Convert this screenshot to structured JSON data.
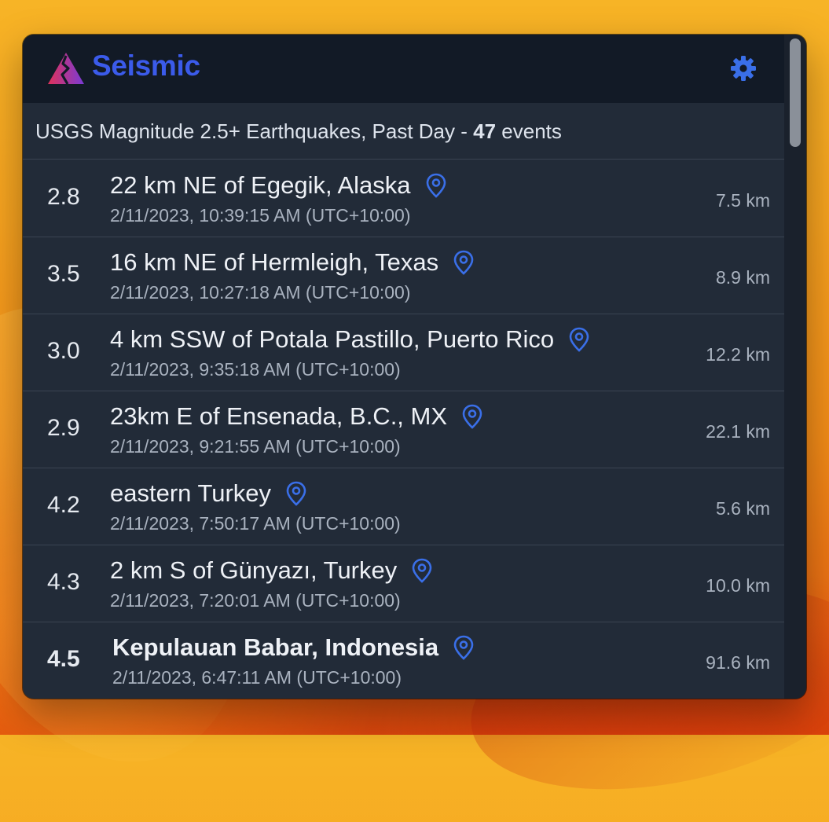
{
  "app": {
    "title": "Seismic",
    "accent_color": "#3b5bea",
    "settings_icon": "gear-icon"
  },
  "summary": {
    "prefix": "USGS Magnitude 2.5+ Earthquakes, Past Day - ",
    "count": "47",
    "suffix": " events"
  },
  "events": [
    {
      "mag": "2.8",
      "place": "22 km NE of Egegik, Alaska",
      "time": "2/11/2023, 10:39:15 AM (UTC+10:00)",
      "depth": "7.5 km"
    },
    {
      "mag": "3.5",
      "place": "16 km NE of Hermleigh, Texas",
      "time": "2/11/2023, 10:27:18 AM (UTC+10:00)",
      "depth": "8.9 km"
    },
    {
      "mag": "3.0",
      "place": "4 km SSW of Potala Pastillo, Puerto Rico",
      "time": "2/11/2023, 9:35:18 AM (UTC+10:00)",
      "depth": "12.2 km"
    },
    {
      "mag": "2.9",
      "place": "23km E of Ensenada, B.C., MX",
      "time": "2/11/2023, 9:21:55 AM (UTC+10:00)",
      "depth": "22.1 km"
    },
    {
      "mag": "4.2",
      "place": "eastern Turkey",
      "time": "2/11/2023, 7:50:17 AM (UTC+10:00)",
      "depth": "5.6 km"
    },
    {
      "mag": "4.3",
      "place": "2 km S of Günyazı, Turkey",
      "time": "2/11/2023, 7:20:01 AM (UTC+10:00)",
      "depth": "10.0 km"
    },
    {
      "mag": "4.5",
      "place": "Kepulauan Babar, Indonesia",
      "time": "2/11/2023, 6:47:11 AM (UTC+10:00)",
      "depth": "91.6 km"
    }
  ]
}
